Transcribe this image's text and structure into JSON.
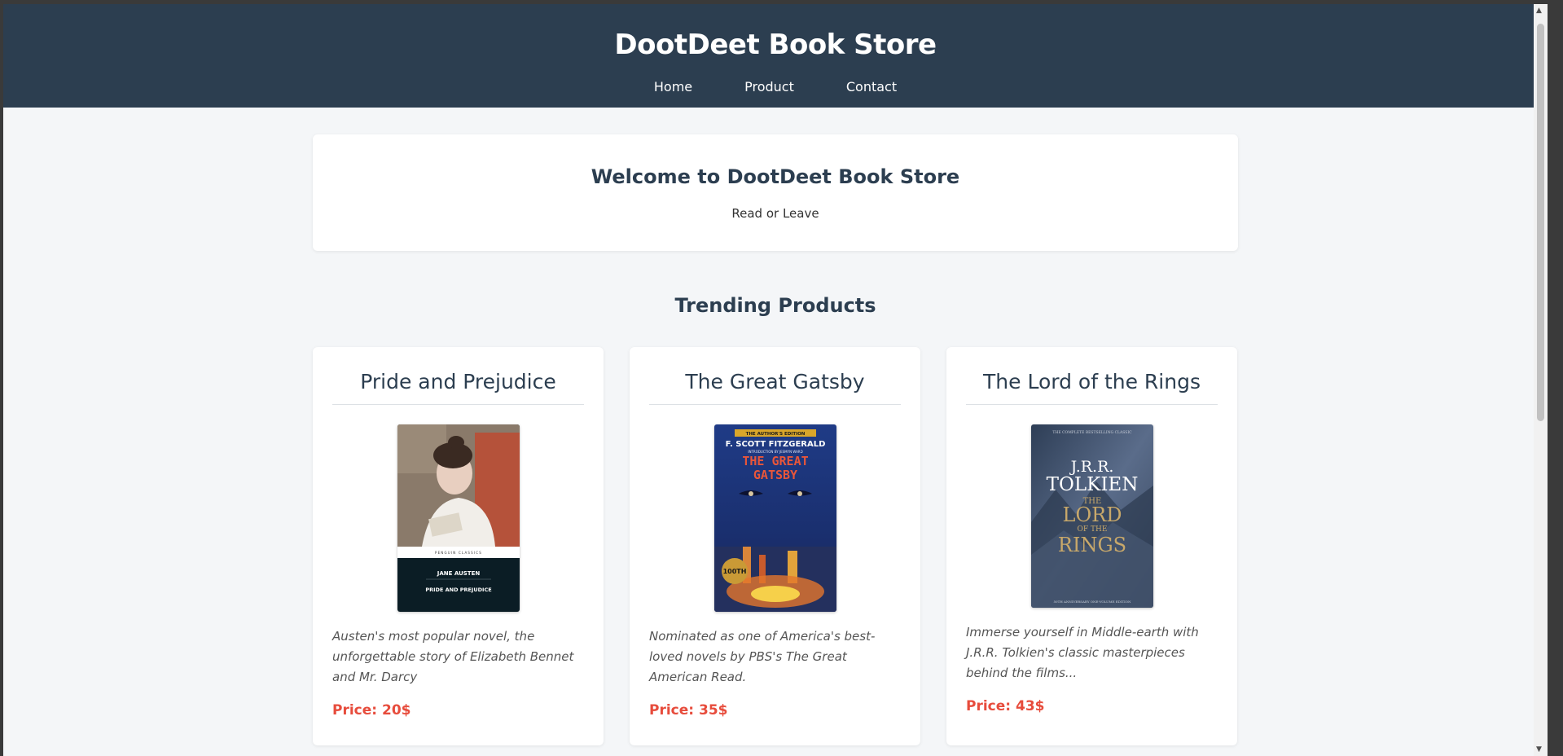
{
  "header": {
    "title": "DootDeet Book Store"
  },
  "nav": {
    "items": [
      "Home",
      "Product",
      "Contact"
    ]
  },
  "welcome": {
    "title": "Welcome to DootDeet Book Store",
    "subtitle": "Read or Leave"
  },
  "trending": {
    "title": "Trending Products"
  },
  "products": [
    {
      "title": "Pride and Prejudice",
      "description": "Austen's most popular novel, the unforgettable story of Elizabeth Bennet and Mr. Darcy",
      "price": "Price: 20$",
      "cover": {
        "author": "JANE AUSTEN",
        "title": "PRIDE AND PREJUDICE",
        "series": "PENGUIN CLASSICS"
      }
    },
    {
      "title": "The Great Gatsby",
      "description": "Nominated as one of America's best-loved novels by PBS's The Great American Read.",
      "price": "Price: 35$",
      "cover": {
        "edition": "THE AUTHOR'S EDITION",
        "author": "F. SCOTT FITZGERALD",
        "intro": "INTRODUCTION BY JESMYN WARD",
        "title_line1": "THE GREAT",
        "title_line2": "GATSBY",
        "badge": "100TH"
      }
    },
    {
      "title": "The Lord of the Rings",
      "description": "Immerse yourself in Middle-earth with J.R.R. Tolkien's classic masterpieces behind the films...",
      "price": "Price: 43$",
      "cover": {
        "tagline": "THE COMPLETE BESTSELLING CLASSIC",
        "author_line1": "J.R.R.",
        "author_line2": "TOLKIEN",
        "title_line1": "THE",
        "title_line2": "LORD",
        "title_line3": "OF THE",
        "title_line4": "RINGS",
        "footer": "50TH ANNIVERSARY ONE-VOLUME EDITION"
      }
    }
  ],
  "colors": {
    "header_bg": "#2c3e50",
    "page_bg": "#f4f6f8",
    "price": "#e74c3c"
  },
  "icons": {
    "scroll_up": "scroll-up-arrow-icon",
    "scroll_down": "scroll-down-arrow-icon"
  }
}
